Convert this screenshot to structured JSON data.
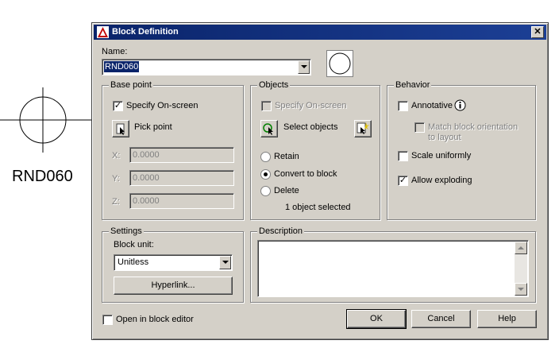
{
  "drawing": {
    "block_label": "RND060"
  },
  "dialog": {
    "title": "Block Definition",
    "close_glyph": "✕",
    "name_label": "Name:",
    "name_value": "RND060",
    "base_point": {
      "title": "Base point",
      "specify_on_screen": {
        "label": "Specify On-screen",
        "checked": true
      },
      "pick_point_label": "Pick point",
      "x_label": "X:",
      "x_value": "0.0000",
      "y_label": "Y:",
      "y_value": "0.0000",
      "z_label": "Z:",
      "z_value": "0.0000"
    },
    "objects": {
      "title": "Objects",
      "specify_on_screen": {
        "label": "Specify On-screen",
        "checked": false,
        "enabled": false
      },
      "select_objects_label": "Select objects",
      "retain_label": "Retain",
      "convert_label": "Convert to block",
      "delete_label": "Delete",
      "selected_mode": "convert",
      "status": "1 object selected"
    },
    "behavior": {
      "title": "Behavior",
      "annotative": {
        "label": "Annotative",
        "checked": false
      },
      "match_orientation": {
        "label_line1": "Match block orientation",
        "label_line2": "to layout",
        "enabled": false
      },
      "scale_uniformly": {
        "label": "Scale uniformly",
        "checked": false
      },
      "allow_exploding": {
        "label": "Allow exploding",
        "checked": true
      }
    },
    "settings": {
      "title": "Settings",
      "block_unit_label": "Block unit:",
      "block_unit_value": "Unitless",
      "hyperlink_label": "Hyperlink..."
    },
    "description": {
      "title": "Description",
      "value": ""
    },
    "open_in_editor": {
      "label": "Open in block editor",
      "checked": false
    },
    "buttons": {
      "ok": "OK",
      "cancel": "Cancel",
      "help": "Help"
    }
  }
}
